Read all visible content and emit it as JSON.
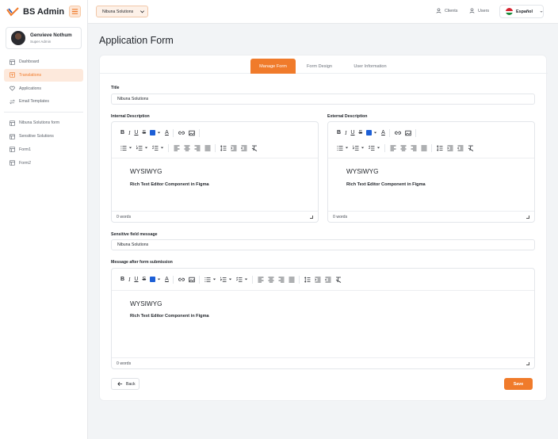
{
  "app": {
    "name": "BS Admin"
  },
  "user": {
    "name": "Genvieve Nothum",
    "role": "Super Admin"
  },
  "nav": {
    "items": [
      {
        "label": "Dashboard",
        "icon": "grid-icon",
        "active": false
      },
      {
        "label": "Translations",
        "icon": "translate-icon",
        "active": true
      },
      {
        "label": "Applications",
        "icon": "heart-icon",
        "active": false
      },
      {
        "label": "Email Templates",
        "icon": "swap-icon",
        "active": false
      }
    ],
    "forms": [
      {
        "label": "Nibuna Solutions form",
        "icon": "grid-icon"
      },
      {
        "label": "Sensitive Solutions",
        "icon": "grid-icon"
      },
      {
        "label": "Form1",
        "icon": "grid-icon"
      },
      {
        "label": "Form2",
        "icon": "grid-icon"
      }
    ]
  },
  "header": {
    "company": "Nibuna Solutions",
    "clients": "Clients",
    "users": "Users",
    "language": "Español"
  },
  "page": {
    "title": "Application Form"
  },
  "tabs": [
    {
      "label": "Manage Form",
      "active": true
    },
    {
      "label": "Form Design",
      "active": false
    },
    {
      "label": "User Information",
      "active": false
    }
  ],
  "form": {
    "title_label": "Title",
    "title_value": "Nibuna Solutions",
    "internal_label": "Internal Description",
    "external_label": "External Description",
    "sensitive_label": "Sensitive field message",
    "sensitive_value": "Nibuna Solutions",
    "submission_label": "Message after form submission"
  },
  "editor": {
    "heading": "WYSIWYG",
    "body": "Rich Text Editor Component in Figma",
    "word_count": "0 words"
  },
  "colors": {
    "accent": "#f07b2b",
    "swatch": "#1d5fd6"
  },
  "buttons": {
    "back": "Back",
    "save": "Save"
  }
}
